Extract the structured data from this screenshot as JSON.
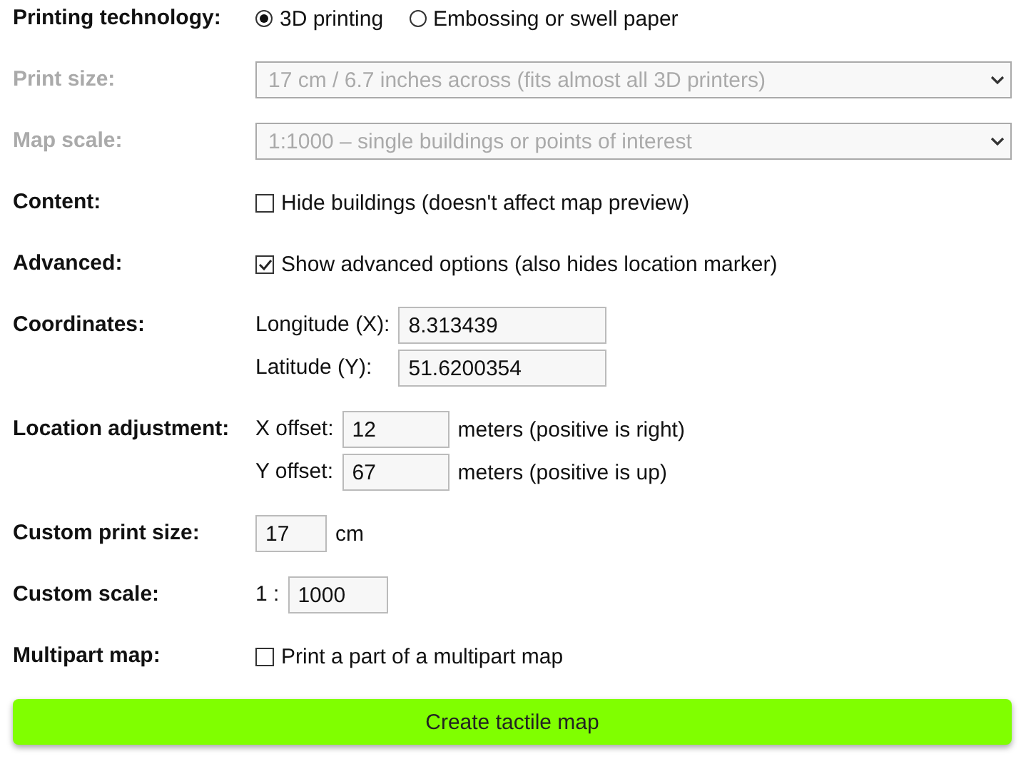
{
  "rows": [
    {
      "kind": "radio",
      "label": "Printing technology:",
      "disabled": false,
      "options": [
        {
          "label": "3D printing",
          "selected": true
        },
        {
          "label": "Embossing or swell paper",
          "selected": false
        }
      ]
    },
    {
      "kind": "select",
      "label": "Print size:",
      "disabled": true,
      "value": "17 cm / 6.7 inches across (fits almost all 3D printers)"
    },
    {
      "kind": "select",
      "label": "Map scale:",
      "disabled": true,
      "value": "1:1000 – single buildings or points of interest"
    },
    {
      "kind": "checkbox",
      "label": "Content:",
      "disabled": false,
      "checked": false,
      "text": "Hide buildings (doesn't affect map preview)"
    },
    {
      "kind": "checkbox",
      "label": "Advanced:",
      "disabled": false,
      "checked": true,
      "text": "Show advanced options (also hides location marker)"
    },
    {
      "kind": "fields",
      "label": "Coordinates:",
      "disabled": false,
      "fields": [
        {
          "label": "Longitude (X):",
          "value": "8.313439"
        },
        {
          "label": "Latitude (Y):",
          "value": "51.6200354"
        }
      ]
    },
    {
      "kind": "fields",
      "label": "Location adjustment:",
      "disabled": false,
      "fields": [
        {
          "label": "X offset:",
          "value": "12",
          "suffix": "meters (positive is right)"
        },
        {
          "label": "Y offset:",
          "value": "67",
          "suffix": "meters (positive is up)"
        }
      ]
    },
    {
      "kind": "fields",
      "label": "Custom print size:",
      "disabled": false,
      "fields": [
        {
          "value": "17",
          "suffix": "cm"
        }
      ]
    },
    {
      "kind": "fields",
      "label": "Custom scale:",
      "disabled": false,
      "fields": [
        {
          "label": "1 :",
          "value": "1000"
        }
      ]
    },
    {
      "kind": "checkbox",
      "label": "Multipart map:",
      "disabled": false,
      "checked": false,
      "text": "Print a part of a multipart map"
    }
  ],
  "button": "Create tactile map"
}
